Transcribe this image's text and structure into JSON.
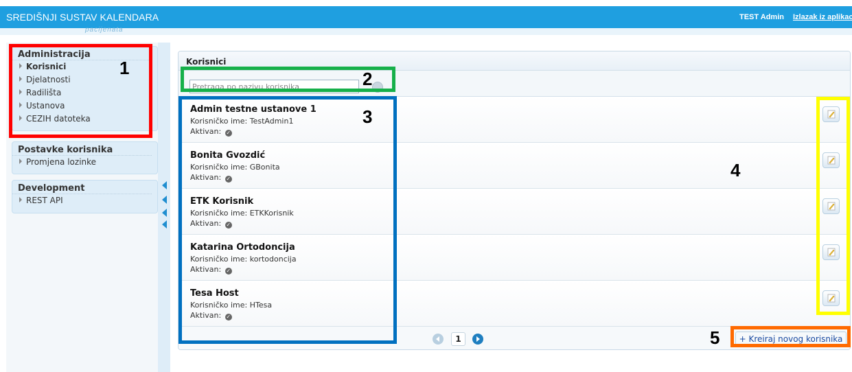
{
  "header": {
    "title": "SREDIŠNJI SUSTAV KALENDARA",
    "subtitle": "pacijenata",
    "user": "TEST Admin",
    "logout": "Izlazak iz aplikacije"
  },
  "sidebar": {
    "groups": [
      {
        "title": "Administracija",
        "items": [
          {
            "label": "Korisnici",
            "active": true
          },
          {
            "label": "Djelatnosti"
          },
          {
            "label": "Radilišta"
          },
          {
            "label": "Ustanova"
          },
          {
            "label": "CEZIH datoteka"
          }
        ]
      },
      {
        "title": "Postavke korisnika",
        "items": [
          {
            "label": "Promjena lozinke"
          }
        ]
      },
      {
        "title": "Development",
        "items": [
          {
            "label": "REST API"
          }
        ]
      }
    ]
  },
  "main": {
    "title": "Korisnici",
    "search": {
      "placeholder": "Pretraga po nazivu korisnika",
      "value": ""
    },
    "users": [
      {
        "name": "Admin testne ustanove 1",
        "login_label": "Korisničko ime:",
        "login": "TestAdmin1",
        "active_label": "Aktivan:"
      },
      {
        "name": "Bonita Gvozdić",
        "login_label": "Korisničko ime:",
        "login": "GBonita",
        "active_label": "Aktivan:"
      },
      {
        "name": "ETK Korisnik",
        "login_label": "Korisničko ime:",
        "login": "ETKKorisnik",
        "active_label": "Aktivan:"
      },
      {
        "name": "Katarina Ortodoncija",
        "login_label": "Korisničko ime:",
        "login": "kortodoncija",
        "active_label": "Aktivan:"
      },
      {
        "name": "Tesa Host",
        "login_label": "Korisničko ime:",
        "login": "HTesa",
        "active_label": "Aktivan:"
      }
    ],
    "pagination": {
      "current_page": "1"
    },
    "create_button": "+ Kreiraj novog korisnika"
  },
  "annotations": {
    "labels": [
      "1",
      "2",
      "3",
      "4",
      "5"
    ],
    "colors": {
      "1": "#ff0000",
      "2": "#16b04a",
      "3": "#0070c0",
      "4": "#ffff00",
      "5": "#ff6a00"
    }
  },
  "colors": {
    "topbar": "#1f9fe0",
    "sidebar_block": "#deedf8",
    "link": "#1a4aa0"
  }
}
